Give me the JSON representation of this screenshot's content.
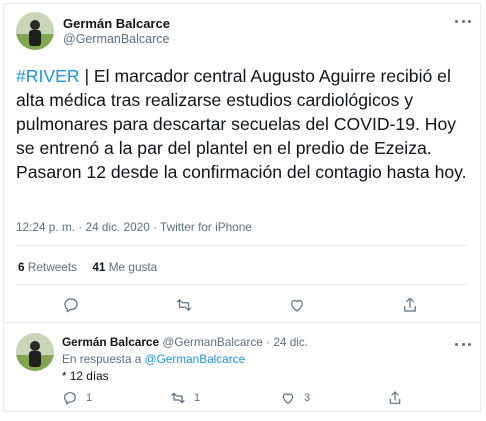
{
  "colors": {
    "accent": "#1b95e0",
    "muted": "#5b7083",
    "text": "#0f1419",
    "border": "#e6ecf0"
  },
  "tweet": {
    "author_name": "Germán Balcarce",
    "author_handle": "@GermanBalcarce",
    "more_icon": "more-dots-icon",
    "hashtag": "#RIVER",
    "text": " | El marcador central Augusto Aguirre recibió el alta médica tras realizarse estudios cardiológicos y pulmonares para descartar secuelas del COVID-19. Hoy se entrenó a la par del plantel en el predio de Ezeiza. Pasaron 12 desde la confirmación del contagio hasta hoy.",
    "meta": "12:24 p. m. · 24 dic. 2020 · Twitter for iPhone",
    "retweets_count": "6",
    "retweets_label": "Retweets",
    "likes_count": "41",
    "likes_label": "Me gusta"
  },
  "reply": {
    "author_name": "Germán Balcarce",
    "author_handle_date": "@GermanBalcarce · 24 dic.",
    "replying_label": "En respuesta a",
    "replying_to": "@GermanBalcarce",
    "text": "* 12 días",
    "reply_count": "1",
    "retweet_count": "1",
    "like_count": "3"
  },
  "icons": [
    "reply-icon",
    "retweet-icon",
    "like-icon",
    "share-icon"
  ]
}
